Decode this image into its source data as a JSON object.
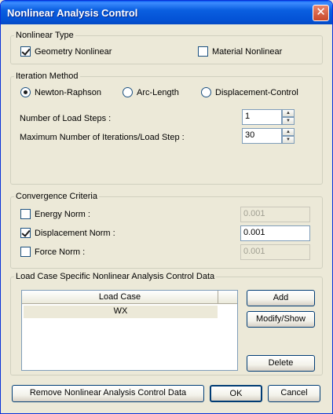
{
  "window": {
    "title": "Nonlinear Analysis Control",
    "close_glyph": "✕"
  },
  "nonlinear_type": {
    "legend": "Nonlinear Type",
    "geometry": {
      "label": "Geometry Nonlinear",
      "checked": true
    },
    "material": {
      "label": "Material Nonlinear",
      "checked": false
    }
  },
  "iteration_method": {
    "legend": "Iteration Method",
    "options": [
      "Newton-Raphson",
      "Arc-Length",
      "Displacement-Control"
    ],
    "selected": "Newton-Raphson",
    "load_steps_label": "Number of Load Steps :",
    "load_steps_value": "1",
    "max_iter_label": "Maximum Number of Iterations/Load Step :",
    "max_iter_value": "30"
  },
  "convergence": {
    "legend": "Convergence Criteria",
    "energy": {
      "label": "Energy Norm :",
      "value": "0.001",
      "checked": false
    },
    "displacement": {
      "label": "Displacement Norm :",
      "value": "0.001",
      "checked": true
    },
    "force": {
      "label": "Force Norm :",
      "value": "0.001",
      "checked": false
    }
  },
  "load_case": {
    "legend": "Load Case Specific Nonlinear Analysis Control Data",
    "column_header": "Load Case",
    "rows": [
      "WX"
    ],
    "add_label": "Add",
    "modify_label": "Modify/Show",
    "delete_label": "Delete"
  },
  "footer": {
    "remove_label": "Remove Nonlinear Analysis Control Data",
    "ok_label": "OK",
    "cancel_label": "Cancel"
  },
  "colors": {
    "title_bar": "#0a5fe0",
    "dialog_bg": "#ece9d8"
  }
}
